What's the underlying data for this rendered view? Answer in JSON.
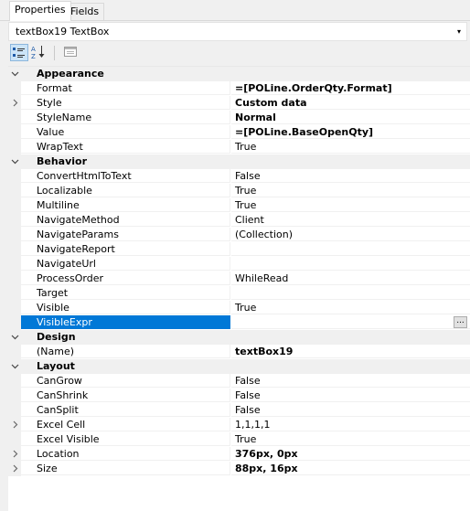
{
  "tabs": [
    "Properties",
    "Fields"
  ],
  "selector": {
    "text": "textBox19  TextBox",
    "arrow": "▾"
  },
  "toolbar": {
    "categorized_icon": "categorized-icon",
    "alphabetical_icon": "az-sort-icon",
    "property_pages_icon": "property-pages-icon"
  },
  "groups": [
    {
      "label": "Appearance",
      "props": [
        {
          "name": "Format",
          "value": "=[POLine.OrderQty.Format]",
          "bold": true
        },
        {
          "name": "Style",
          "value": "Custom data",
          "bold": true,
          "expandable": true
        },
        {
          "name": "StyleName",
          "value": "Normal",
          "bold": true
        },
        {
          "name": "Value",
          "value": "=[POLine.BaseOpenQty]",
          "bold": true
        },
        {
          "name": "WrapText",
          "value": "True"
        }
      ]
    },
    {
      "label": "Behavior",
      "props": [
        {
          "name": "ConvertHtmlToText",
          "value": "False"
        },
        {
          "name": "Localizable",
          "value": "True"
        },
        {
          "name": "Multiline",
          "value": "True"
        },
        {
          "name": "NavigateMethod",
          "value": "Client"
        },
        {
          "name": "NavigateParams",
          "value": "(Collection)"
        },
        {
          "name": "NavigateReport",
          "value": ""
        },
        {
          "name": "NavigateUrl",
          "value": ""
        },
        {
          "name": "ProcessOrder",
          "value": "WhileRead"
        },
        {
          "name": "Target",
          "value": ""
        },
        {
          "name": "Visible",
          "value": "True"
        },
        {
          "name": "VisibleExpr",
          "value": "",
          "selected": true,
          "ellipsis": "..."
        }
      ]
    },
    {
      "label": "Design",
      "props": [
        {
          "name": "(Name)",
          "value": "textBox19",
          "bold": true
        }
      ]
    },
    {
      "label": "Layout",
      "props": [
        {
          "name": "CanGrow",
          "value": "False"
        },
        {
          "name": "CanShrink",
          "value": "False"
        },
        {
          "name": "CanSplit",
          "value": "False"
        },
        {
          "name": "Excel Cell",
          "value": "1,1,1,1",
          "expandable": true
        },
        {
          "name": "Excel Visible",
          "value": "True"
        },
        {
          "name": "Location",
          "value": "376px, 0px",
          "bold": true,
          "expandable": true
        },
        {
          "name": "Size",
          "value": "88px, 16px",
          "bold": true,
          "expandable": true
        }
      ]
    }
  ]
}
